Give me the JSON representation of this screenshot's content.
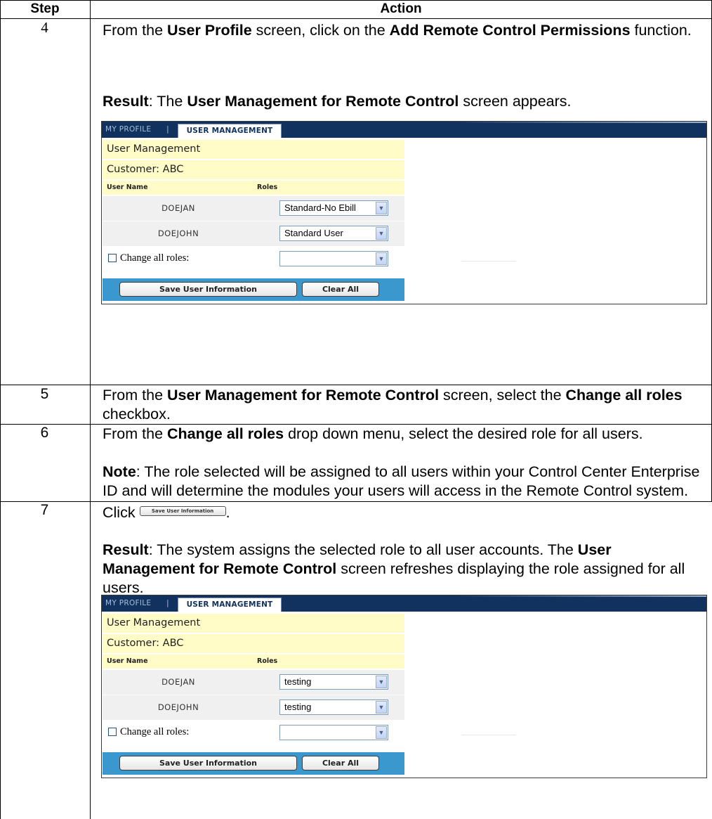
{
  "table": {
    "header_step": "Step",
    "header_action": "Action",
    "rows": [
      {
        "step": "4",
        "para1_pre": "From the ",
        "para1_b1": "User Profile",
        "para1_mid": " screen, click on the ",
        "para1_b2": "Add Remote Control Permissions",
        "para1_post": " function.",
        "result_label": "Result",
        "result_pre": ":  The ",
        "result_b": "User Management for Remote Control",
        "result_post": " screen appears."
      },
      {
        "step": "5",
        "pre": "From the ",
        "b1": "User Management for Remote Control",
        "mid": " screen, select the ",
        "b2": "Change all roles",
        "post": " checkbox."
      },
      {
        "step": "6",
        "pre": "From the ",
        "b1": "Change all roles",
        "post": " drop down menu, select the desired role for all users.",
        "note_label": "Note",
        "note_text": ":  The role selected will be assigned to all users within your Control Center Enterprise ID and will determine the modules your users will access in the Remote Control system."
      },
      {
        "step": "7",
        "click": "Click ",
        "inline_button": "Save User Information",
        "after_button": ".",
        "result_label": "Result",
        "result_text": ":  The system assigns the selected role to all user accounts.  The ",
        "result_b": "User Management for Remote Control",
        "result_post": " screen refreshes displaying the role assigned for all users."
      }
    ]
  },
  "screenshot1": {
    "nav_my_profile": "MY PROFILE",
    "nav_separator": "|",
    "nav_user_management": "USER MANAGEMENT",
    "title": "User Management",
    "customer": "Customer:  ABC",
    "col_user": "User Name",
    "col_roles": "Roles",
    "users": [
      {
        "name": "DOEJAN",
        "role": "Standard-No Ebill"
      },
      {
        "name": "DOEJOHN",
        "role": "Standard User"
      }
    ],
    "change_all_label": "Change all roles:",
    "change_all_value": "",
    "save_button": "Save User Information",
    "clear_button": "Clear All"
  },
  "screenshot2": {
    "nav_my_profile": "MY PROFILE",
    "nav_separator": "|",
    "nav_user_management": "USER MANAGEMENT",
    "title": "User Management",
    "customer": "Customer:  ABC",
    "col_user": "User Name",
    "col_roles": "Roles",
    "users": [
      {
        "name": "DOEJAN",
        "role": "testing"
      },
      {
        "name": "DOEJOHN",
        "role": "testing"
      }
    ],
    "change_all_label": "Change all roles:",
    "change_all_value": "",
    "save_button": "Save User Information",
    "clear_button": "Clear All"
  },
  "icons": {
    "select_arrow": "chevron-down-icon",
    "checkbox": "checkbox-icon"
  }
}
